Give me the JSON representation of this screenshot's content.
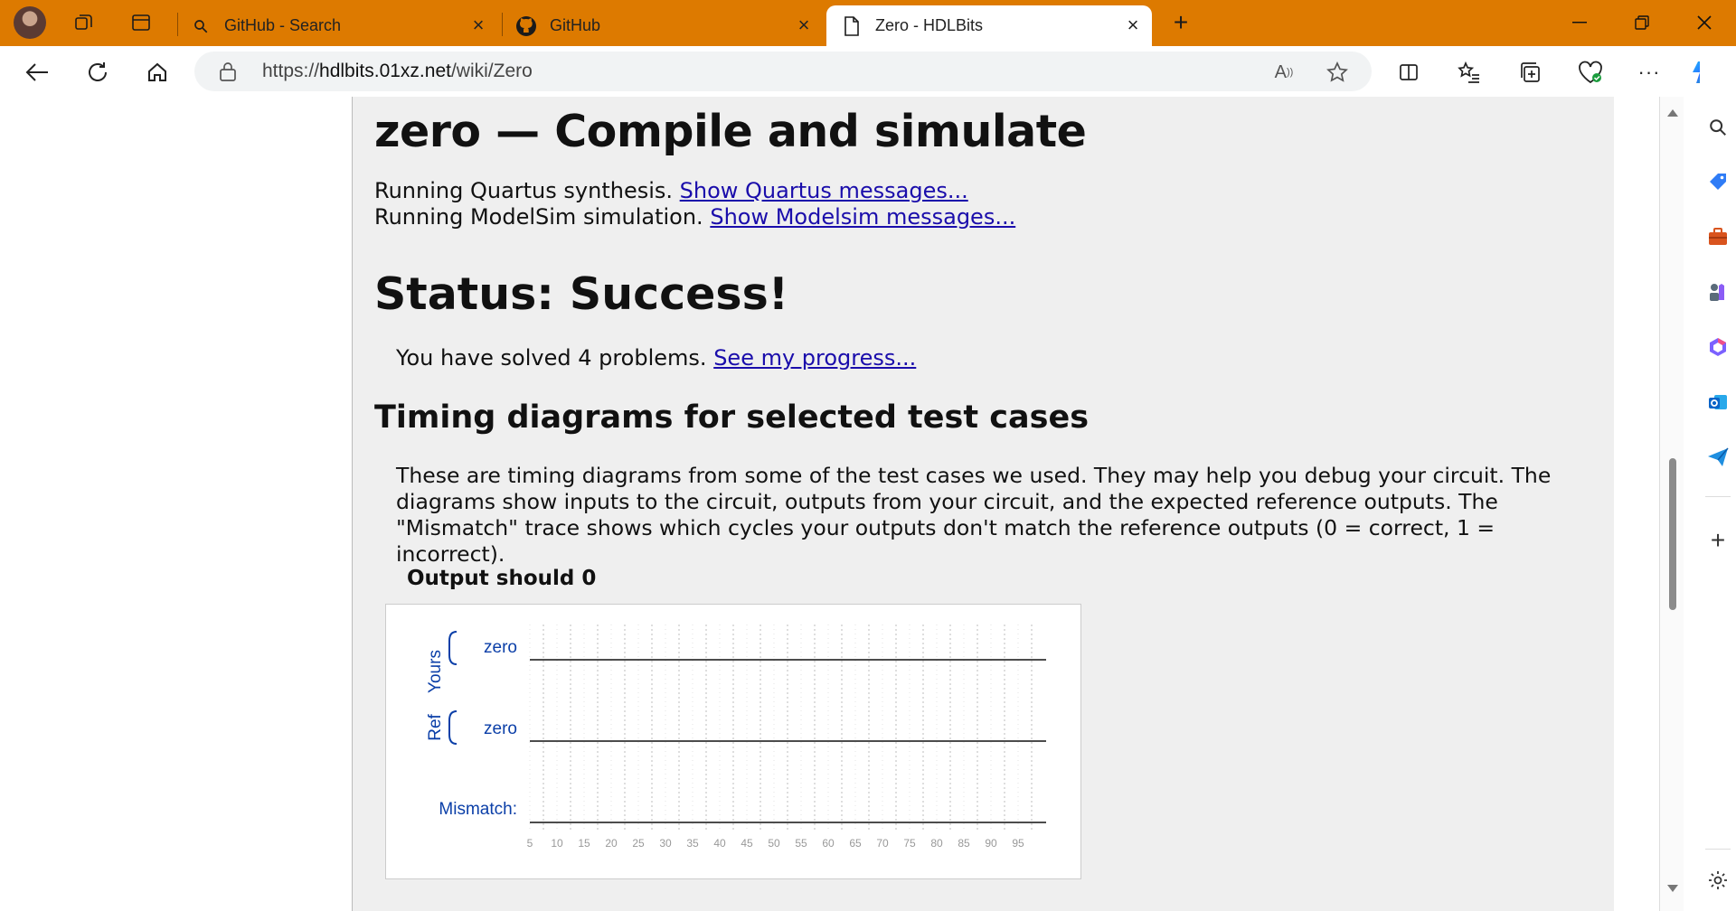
{
  "tabs": [
    {
      "label": "GitHub - Search",
      "icon": "search-icon"
    },
    {
      "label": "GitHub",
      "icon": "github-icon"
    },
    {
      "label": "Zero - HDLBits",
      "icon": "page-icon",
      "active": true
    }
  ],
  "address": {
    "prefix": "https://",
    "host": "hdlbits.01xz.net",
    "path": "/wiki/Zero"
  },
  "page": {
    "title": "zero — Compile and simulate",
    "quartus_text": "Running Quartus synthesis.",
    "quartus_link": "Show Quartus messages...",
    "modelsim_text": "Running ModelSim simulation.",
    "modelsim_link": "Show Modelsim messages...",
    "status": "Status: Success!",
    "solved_text": "You have solved 4 problems.",
    "progress_link": "See my progress...",
    "timing_heading": "Timing diagrams for selected test cases",
    "timing_desc": "These are timing diagrams from some of the test cases we used. They may help you debug your circuit. The diagrams show inputs to the circuit, outputs from your circuit, and the expected reference outputs. The \"Mismatch\" trace shows which cycles your outputs don't match the reference outputs (0 = correct, 1 = incorrect).",
    "wave_title": "Output should 0"
  },
  "waveform": {
    "group_yours": "Yours",
    "group_ref": "Ref",
    "signal_yours": "zero",
    "signal_ref": "zero",
    "mismatch_label": "Mismatch:",
    "ticks": [
      "5",
      "10",
      "15",
      "20",
      "25",
      "30",
      "35",
      "40",
      "45",
      "50",
      "55",
      "60",
      "65",
      "70",
      "75",
      "80",
      "85",
      "90",
      "95"
    ],
    "signal_value": 0,
    "label_color": "#0b3fa8"
  },
  "colors": {
    "titlebar": "#dd7a00",
    "link": "#1a0dab"
  }
}
